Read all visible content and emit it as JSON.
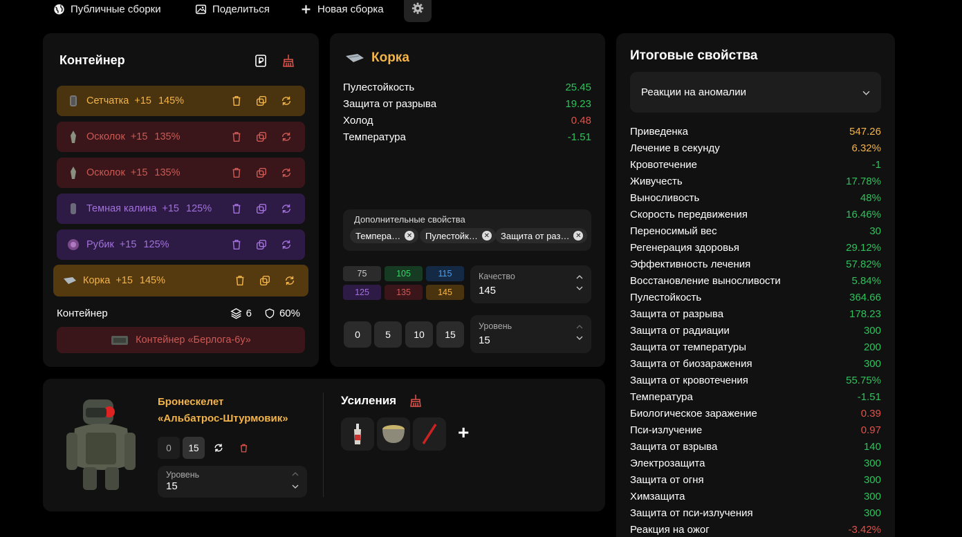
{
  "topbar": {
    "public_builds": "Публичные сборки",
    "share": "Поделиться",
    "new_build": "Новая сборка"
  },
  "container_panel": {
    "title": "Контейнер",
    "slots": [
      {
        "name": "Сетчатка",
        "level": "+15",
        "quality": "145%",
        "color": "gold"
      },
      {
        "name": "Осколок",
        "level": "+15",
        "quality": "135%",
        "color": "red"
      },
      {
        "name": "Осколок",
        "level": "+15",
        "quality": "135%",
        "color": "red"
      },
      {
        "name": "Темная калина",
        "level": "+15",
        "quality": "125%",
        "color": "purple"
      },
      {
        "name": "Рубик",
        "level": "+15",
        "quality": "125%",
        "color": "purple"
      },
      {
        "name": "Корка",
        "level": "+15",
        "quality": "145%",
        "color": "gold"
      }
    ],
    "footer_label": "Контейнер",
    "capacity": "6",
    "protection": "60%",
    "container_button": "Контейнер «Берлога-6у»"
  },
  "item_panel": {
    "title": "Корка",
    "properties": [
      {
        "label": "Пулестойкость",
        "value": "25.45"
      },
      {
        "label": "Защита от разрыва",
        "value": "19.23"
      },
      {
        "label": "Холод",
        "value": "0.48"
      },
      {
        "label": "Температура",
        "value": "-1.51"
      }
    ],
    "extra_label": "Дополнительные свойства",
    "chips": [
      "Темпера…",
      "Пулестойк…",
      "Защита от раз…"
    ],
    "quality_options": [
      "75",
      "105",
      "115",
      "125",
      "135",
      "145"
    ],
    "quality_label": "Качество",
    "quality_value": "145",
    "level_buttons": [
      "0",
      "5",
      "10",
      "15"
    ],
    "level_label": "Уровень",
    "level_value": "15"
  },
  "summary_panel": {
    "title": "Итоговые свойства",
    "dropdown_value": "Реакции на аномалии",
    "rows": [
      {
        "label": "Приведенка",
        "value": "547.26",
        "color": "orange"
      },
      {
        "label": "Лечение в секунду",
        "value": "6.32%",
        "color": "orange"
      },
      {
        "label": "Кровотечение",
        "value": "-1",
        "color": "green"
      },
      {
        "label": "Живучесть",
        "value": "17.78%",
        "color": "green"
      },
      {
        "label": "Выносливость",
        "value": "48%",
        "color": "green"
      },
      {
        "label": "Скорость передвижения",
        "value": "16.46%",
        "color": "green"
      },
      {
        "label": "Переносимый вес",
        "value": "30",
        "color": "green"
      },
      {
        "label": "Регенерация здоровья",
        "value": "29.12%",
        "color": "green"
      },
      {
        "label": "Эффективность лечения",
        "value": "57.82%",
        "color": "green"
      },
      {
        "label": "Восстановление выносливости",
        "value": "5.84%",
        "color": "green"
      },
      {
        "label": "Пулестойкость",
        "value": "364.66",
        "color": "green"
      },
      {
        "label": "Защита от разрыва",
        "value": "178.23",
        "color": "green"
      },
      {
        "label": "Защита от радиации",
        "value": "300",
        "color": "green"
      },
      {
        "label": "Защита от температуры",
        "value": "200",
        "color": "green"
      },
      {
        "label": "Защита от биозаражения",
        "value": "300",
        "color": "green"
      },
      {
        "label": "Защита от кровотечения",
        "value": "55.75%",
        "color": "green"
      },
      {
        "label": "Температура",
        "value": "-1.51",
        "color": "green"
      },
      {
        "label": "Биологическое заражение",
        "value": "0.39",
        "color": "red"
      },
      {
        "label": "Пси-излучение",
        "value": "0.97",
        "color": "red"
      },
      {
        "label": "Защита от взрыва",
        "value": "140",
        "color": "green"
      },
      {
        "label": "Электрозащита",
        "value": "300",
        "color": "green"
      },
      {
        "label": "Защита от огня",
        "value": "300",
        "color": "green"
      },
      {
        "label": "Химзащита",
        "value": "300",
        "color": "green"
      },
      {
        "label": "Защита от пси-излучения",
        "value": "300",
        "color": "green"
      },
      {
        "label": "Реакция на ожог",
        "value": "-3.42%",
        "color": "red"
      }
    ]
  },
  "armor_panel": {
    "name_line1": "Бронескелет",
    "name_line2": "«Альбатрос-Штурмовик»",
    "level_buttons": [
      "0",
      "15"
    ],
    "level_label": "Уровень",
    "level_value": "15",
    "boosts_title": "Усиления",
    "add_symbol": "+"
  },
  "colors": {
    "gold": "#f3b44a",
    "red": "#cc5a55",
    "purple": "#a271dc",
    "green": "#2fc25b",
    "panel": "#111111"
  }
}
